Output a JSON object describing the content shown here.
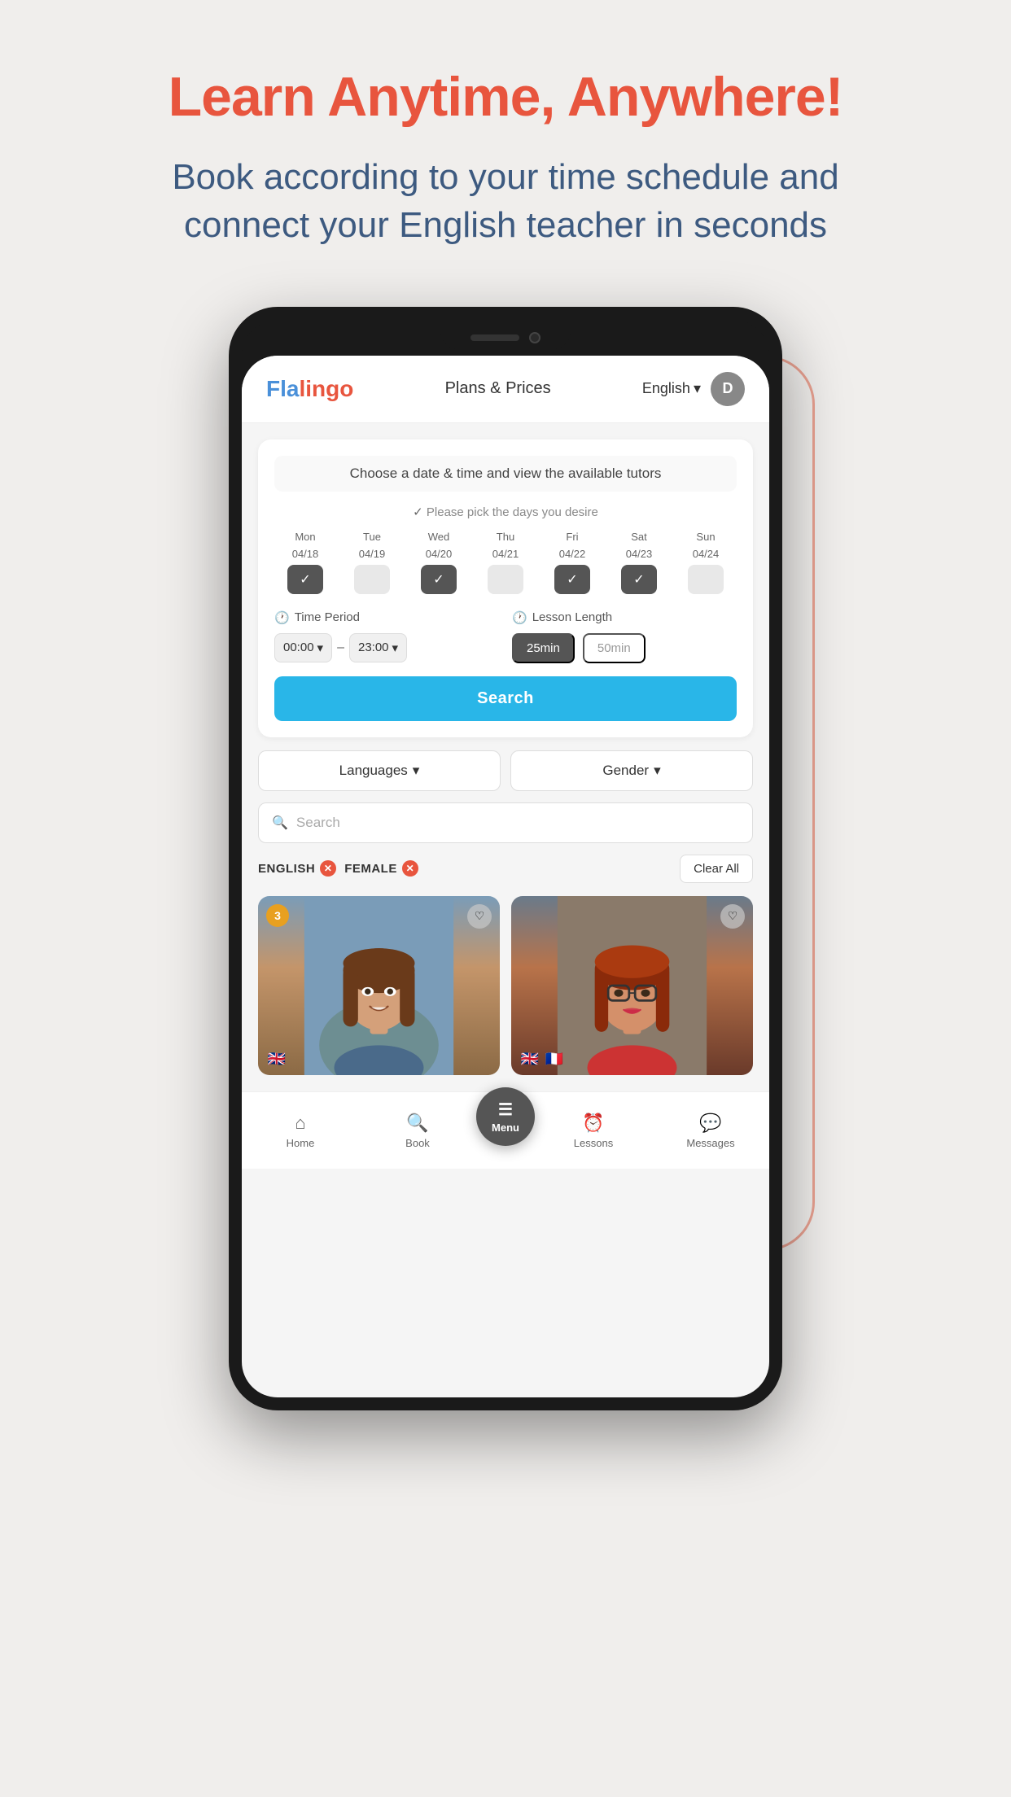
{
  "page": {
    "title": "Learn Anytime, Anywhere!",
    "subtitle": "Book according to your time schedule and connect your English teacher in seconds",
    "bg_color": "#f0eeec"
  },
  "header": {
    "logo_fla": "Fla",
    "logo_lingo": "lingo",
    "plans_label": "Plans & Prices",
    "lang_label": "English",
    "lang_arrow": "▾",
    "user_initial": "D"
  },
  "date_picker": {
    "hint": "Choose a date & time and view the available tutors",
    "day_hint": "Please pick the days you desire",
    "days": [
      {
        "short": "Mon",
        "date": "04/18",
        "checked": true
      },
      {
        "short": "Tue",
        "date": "04/19",
        "checked": false
      },
      {
        "short": "Wed",
        "date": "04/20",
        "checked": true
      },
      {
        "short": "Thu",
        "date": "04/21",
        "checked": false
      },
      {
        "short": "Fri",
        "date": "04/22",
        "checked": true
      },
      {
        "short": "Sat",
        "date": "04/23",
        "checked": true
      },
      {
        "short": "Sun",
        "date": "04/24",
        "checked": false
      }
    ]
  },
  "time_period": {
    "label": "Time Period",
    "start": "00:00",
    "end": "23:00"
  },
  "lesson": {
    "label": "Lesson Length",
    "options": [
      "25min",
      "50min"
    ],
    "selected": "25min"
  },
  "search_btn": "Search",
  "filters": {
    "languages_label": "Languages",
    "gender_label": "Gender",
    "search_placeholder": "Search",
    "active_filters": [
      "ENGLISH",
      "FEMALE"
    ],
    "clear_all": "Clear All"
  },
  "tutors": [
    {
      "badge": "3",
      "flags": [
        "🇬🇧"
      ],
      "has_heart": true
    },
    {
      "badge": null,
      "flags": [
        "🇬🇧",
        "🇫🇷"
      ],
      "has_heart": true
    }
  ],
  "nav": {
    "home": "Home",
    "book": "Book",
    "menu": "Menu",
    "lessons": "Lessons",
    "messages": "Messages"
  }
}
